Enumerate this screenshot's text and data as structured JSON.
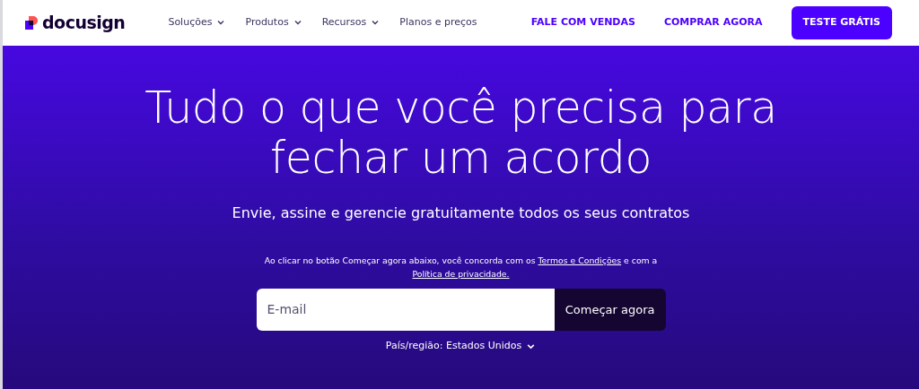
{
  "logo": {
    "text": "docusign"
  },
  "nav": [
    {
      "label": "Soluções",
      "dropdown": true
    },
    {
      "label": "Produtos",
      "dropdown": true
    },
    {
      "label": "Recursos",
      "dropdown": true
    },
    {
      "label": "Planos e preços",
      "dropdown": false
    }
  ],
  "actions": [
    {
      "label": "FALE COM VENDAS",
      "kind": "link"
    },
    {
      "label": "COMPRAR AGORA",
      "kind": "link"
    },
    {
      "label": "TESTE GRÁTIS",
      "kind": "button"
    }
  ],
  "hero": {
    "title": "Tudo o que você precisa para fechar um acordo",
    "subtitle": "Envie, assine e gerencie gratuitamente todos os seus contratos",
    "consent": [
      {
        "kind": "text",
        "text": "Ao clicar no botão Começar agora abaixo, você concorda com os"
      },
      {
        "kind": "link",
        "text": "Termos e Condições"
      },
      {
        "kind": "text",
        "text": "e com a"
      },
      {
        "kind": "link",
        "text": "Política de privacidade."
      }
    ],
    "email": {
      "placeholder": "E-mail"
    },
    "submit": "Começar agora",
    "region": {
      "label": "País/região: Estados Unidos",
      "dropdown": true
    }
  }
}
